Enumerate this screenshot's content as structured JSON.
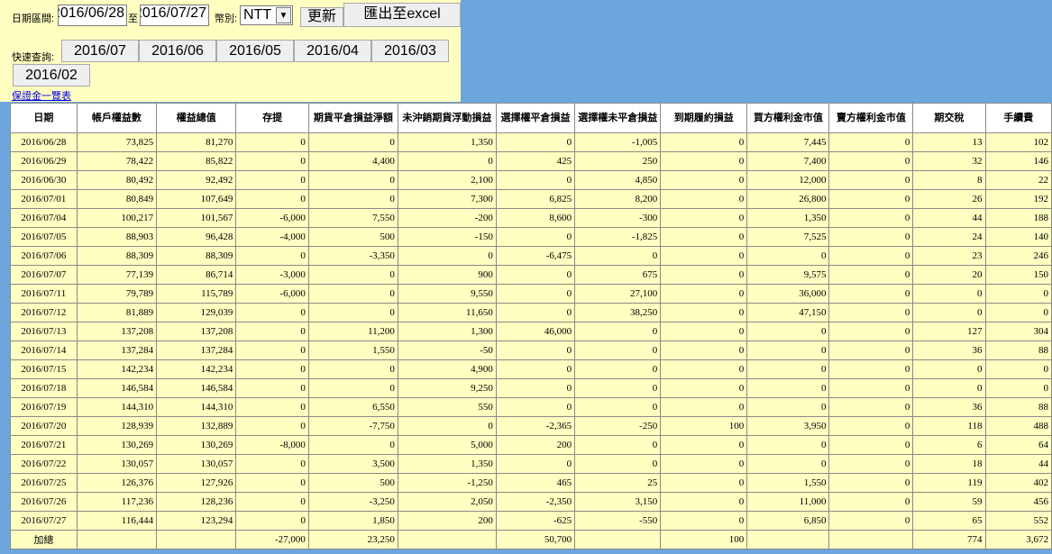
{
  "filter": {
    "date_range_label": "日期區間:",
    "start_date": "2016/06/28",
    "to_label": "至",
    "end_date": "2016/07/27",
    "currency_label": "幣別:",
    "currency_value": "NTT",
    "refresh_label": "更新",
    "export_label": "匯出至excel"
  },
  "quick": {
    "label": "快速查詢:",
    "months": [
      "2016/07",
      "2016/06",
      "2016/05",
      "2016/04",
      "2016/03",
      "2016/02"
    ]
  },
  "margin_link": "保證金一覽表",
  "table": {
    "columns": [
      "日期",
      "帳戶權益數",
      "權益總值",
      "存提",
      "期貨平倉損益淨額",
      "未沖銷期貨浮動損益",
      "選擇權平倉損益",
      "選擇權未平倉損益",
      "到期履約損益",
      "買方權利金市值",
      "賣方權利金市值",
      "期交稅",
      "手續費"
    ],
    "rows": [
      [
        "2016/06/28",
        "73,825",
        "81,270",
        "0",
        "0",
        "1,350",
        "0",
        "-1,005",
        "0",
        "7,445",
        "0",
        "13",
        "102"
      ],
      [
        "2016/06/29",
        "78,422",
        "85,822",
        "0",
        "4,400",
        "0",
        "425",
        "250",
        "0",
        "7,400",
        "0",
        "32",
        "146"
      ],
      [
        "2016/06/30",
        "80,492",
        "92,492",
        "0",
        "0",
        "2,100",
        "0",
        "4,850",
        "0",
        "12,000",
        "0",
        "8",
        "22"
      ],
      [
        "2016/07/01",
        "80,849",
        "107,649",
        "0",
        "0",
        "7,300",
        "6,825",
        "8,200",
        "0",
        "26,800",
        "0",
        "26",
        "192"
      ],
      [
        "2016/07/04",
        "100,217",
        "101,567",
        "-6,000",
        "7,550",
        "-200",
        "8,600",
        "-300",
        "0",
        "1,350",
        "0",
        "44",
        "188"
      ],
      [
        "2016/07/05",
        "88,903",
        "96,428",
        "-4,000",
        "500",
        "-150",
        "0",
        "-1,825",
        "0",
        "7,525",
        "0",
        "24",
        "140"
      ],
      [
        "2016/07/06",
        "88,309",
        "88,309",
        "0",
        "-3,350",
        "0",
        "-6,475",
        "0",
        "0",
        "0",
        "0",
        "23",
        "246"
      ],
      [
        "2016/07/07",
        "77,139",
        "86,714",
        "-3,000",
        "0",
        "900",
        "0",
        "675",
        "0",
        "9,575",
        "0",
        "20",
        "150"
      ],
      [
        "2016/07/11",
        "79,789",
        "115,789",
        "-6,000",
        "0",
        "9,550",
        "0",
        "27,100",
        "0",
        "36,000",
        "0",
        "0",
        "0"
      ],
      [
        "2016/07/12",
        "81,889",
        "129,039",
        "0",
        "0",
        "11,650",
        "0",
        "38,250",
        "0",
        "47,150",
        "0",
        "0",
        "0"
      ],
      [
        "2016/07/13",
        "137,208",
        "137,208",
        "0",
        "11,200",
        "1,300",
        "46,000",
        "0",
        "0",
        "0",
        "0",
        "127",
        "304"
      ],
      [
        "2016/07/14",
        "137,284",
        "137,284",
        "0",
        "1,550",
        "-50",
        "0",
        "0",
        "0",
        "0",
        "0",
        "36",
        "88"
      ],
      [
        "2016/07/15",
        "142,234",
        "142,234",
        "0",
        "0",
        "4,900",
        "0",
        "0",
        "0",
        "0",
        "0",
        "0",
        "0"
      ],
      [
        "2016/07/18",
        "146,584",
        "146,584",
        "0",
        "0",
        "9,250",
        "0",
        "0",
        "0",
        "0",
        "0",
        "0",
        "0"
      ],
      [
        "2016/07/19",
        "144,310",
        "144,310",
        "0",
        "6,550",
        "550",
        "0",
        "0",
        "0",
        "0",
        "0",
        "36",
        "88"
      ],
      [
        "2016/07/20",
        "128,939",
        "132,889",
        "0",
        "-7,750",
        "0",
        "-2,365",
        "-250",
        "100",
        "3,950",
        "0",
        "118",
        "488"
      ],
      [
        "2016/07/21",
        "130,269",
        "130,269",
        "-8,000",
        "0",
        "5,000",
        "200",
        "0",
        "0",
        "0",
        "0",
        "6",
        "64"
      ],
      [
        "2016/07/22",
        "130,057",
        "130,057",
        "0",
        "3,500",
        "1,350",
        "0",
        "0",
        "0",
        "0",
        "0",
        "18",
        "44"
      ],
      [
        "2016/07/25",
        "126,376",
        "127,926",
        "0",
        "500",
        "-1,250",
        "465",
        "25",
        "0",
        "1,550",
        "0",
        "119",
        "402"
      ],
      [
        "2016/07/26",
        "117,236",
        "128,236",
        "0",
        "-3,250",
        "2,050",
        "-2,350",
        "3,150",
        "0",
        "11,000",
        "0",
        "59",
        "456"
      ],
      [
        "2016/07/27",
        "116,444",
        "123,294",
        "0",
        "1,850",
        "200",
        "-625",
        "-550",
        "0",
        "6,850",
        "0",
        "65",
        "552"
      ]
    ],
    "total": [
      "加總",
      "",
      "",
      "-27,000",
      "23,250",
      "",
      "50,700",
      "",
      "100",
      "",
      "",
      "774",
      "3,672"
    ]
  }
}
